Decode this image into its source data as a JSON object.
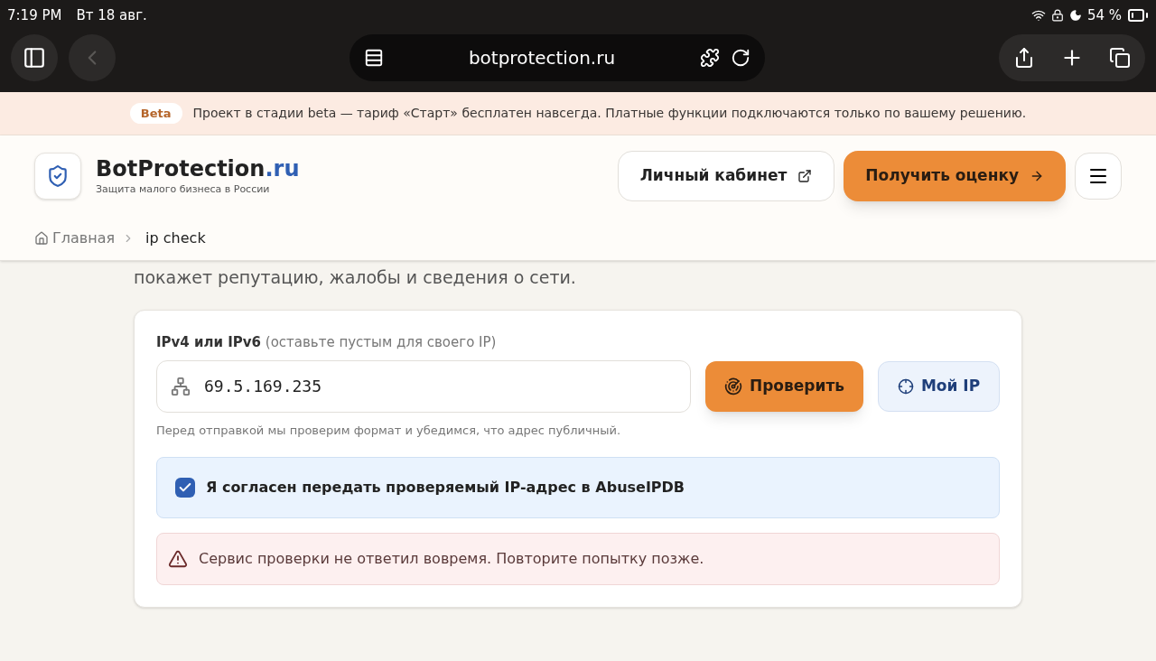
{
  "status_bar": {
    "time": "7:19 PM",
    "date": "Вт 18 авг.",
    "battery": "54 %"
  },
  "browser": {
    "url": "botprotection.ru",
    "back_disabled": true
  },
  "banner": {
    "badge": "Beta",
    "text": "Проект в стадии beta — тариф «Старт» бесплатен навсегда. Платные функции подключаются только по вашему решению."
  },
  "header": {
    "brand": "BotProtection",
    "brand_suffix": ".ru",
    "tagline": "Защита малого бизнеса в России",
    "account_button": "Личный кабинет",
    "cta_button": "Получить оценку"
  },
  "breadcrumbs": [
    {
      "label": "Главная",
      "kind": "home"
    },
    {
      "label": "ip check",
      "kind": "current"
    }
  ],
  "intro": "покажет репутацию, жалобы и сведения о сети.",
  "form": {
    "label": "IPv4 или IPv6",
    "label_hint": "(оставьте пустым для своего IP)",
    "value": "69.5.169.235",
    "check_button": "Проверить",
    "my_ip_button": "Мой IP",
    "help": "Перед отправкой мы проверим формат и убедимся, что адрес публичный.",
    "consent": {
      "text": "Я согласен передать проверяемый IP-адрес в AbuseIPDB",
      "checked": true
    },
    "error": "Сервис проверки не ответил вовремя. Повторите попытку позже."
  }
}
